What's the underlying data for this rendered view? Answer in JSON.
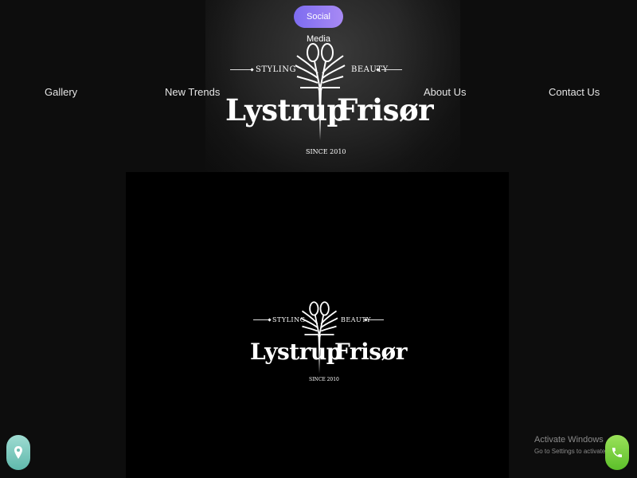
{
  "header": {
    "social_button_label": "Social Media",
    "nav": {
      "gallery": "Gallery",
      "new_trends": "New Trends",
      "about_us": "About Us",
      "contact_us": "Contact Us"
    }
  },
  "logo": {
    "brand_left": "Lystrup",
    "brand_right": "Frisør",
    "tag_left": "STYLING",
    "tag_right": "BEAUTY",
    "since": "SINCE 2010"
  },
  "floating_buttons": {
    "location_icon": "map-pin-icon",
    "phone_icon": "phone-icon",
    "location_color": "#7fcbbf",
    "phone_color": "#7ad042"
  },
  "watermark": {
    "line1": "Activate Windows",
    "line2": "Go to Settings to activate Windo"
  },
  "colors": {
    "background": "#0d0d0d",
    "panel": "#000000",
    "accent": "#8f7bf2"
  }
}
